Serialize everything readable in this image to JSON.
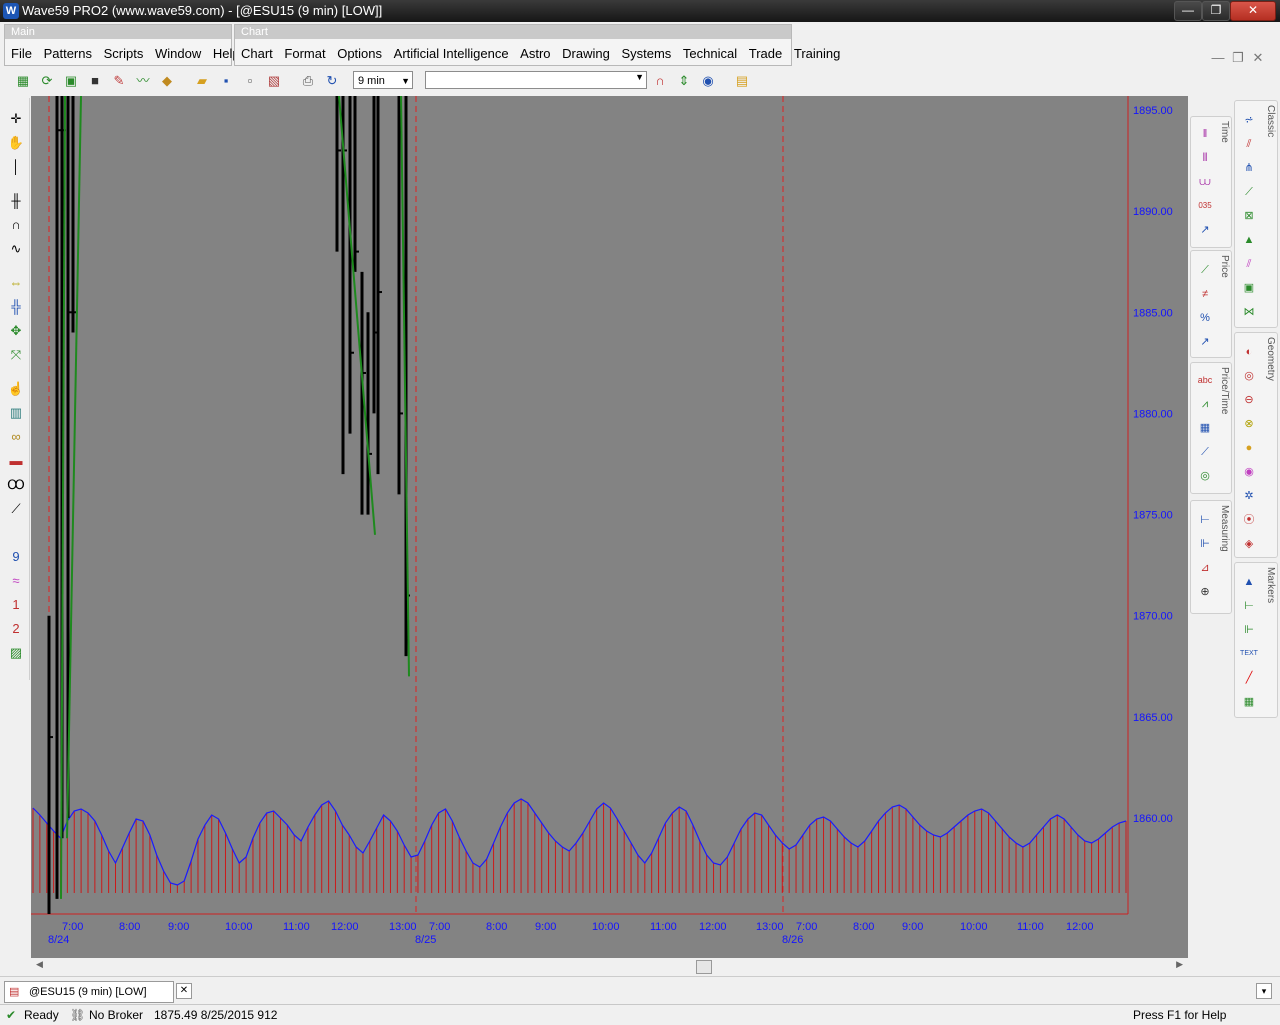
{
  "window": {
    "title": "Wave59 PRO2 (www.wave59.com) - [@ESU15 (9 min) [LOW]]",
    "logo_letter": "W",
    "controls": {
      "minimize": "—",
      "restore": "❐",
      "close": "✕"
    }
  },
  "menus": {
    "main_band_title": "Main",
    "main_items": [
      "File",
      "Patterns",
      "Scripts",
      "Window",
      "Help"
    ],
    "chart_band_title": "Chart",
    "chart_items": [
      "Chart",
      "Format",
      "Options",
      "Artificial Intelligence",
      "Astro",
      "Drawing",
      "Systems",
      "Technical",
      "Trade",
      "Training"
    ]
  },
  "mdi_controls": {
    "minimize": "—",
    "restore": "❐",
    "close": "✕"
  },
  "toolbar": {
    "interval_value": "9 min",
    "symbol_value": ""
  },
  "right_panels": {
    "time": "Time",
    "price": "Price",
    "price_time": "Price/Time",
    "measuring": "Measuring",
    "classic": "Classic",
    "geometry": "Geometry",
    "markers": "Markers"
  },
  "chart_data": {
    "type": "bar",
    "symbol": "@ESU15",
    "interval": "9 min",
    "price_axis_ticks": [
      "1895.00",
      "1890.00",
      "1885.00",
      "1880.00",
      "1875.00",
      "1870.00",
      "1865.00",
      "1860.00"
    ],
    "price_axis_values": [
      1895,
      1890,
      1885,
      1880,
      1875,
      1870,
      1865,
      1860
    ],
    "time_axis_ticks": [
      "7:00",
      "8:00",
      "9:00",
      "10:00",
      "11:00",
      "12:00",
      "13:00",
      "7:00",
      "8:00",
      "9:00",
      "10:00",
      "11:00",
      "12:00",
      "13:00",
      "7:00",
      "8:00",
      "9:00",
      "10:00",
      "11:00",
      "12:00"
    ],
    "date_labels": [
      "8/24",
      "8/25",
      "8/26"
    ],
    "session_breaks": [
      "8/24",
      "8/25",
      "8/26"
    ],
    "ylim": [
      1855,
      1896
    ],
    "price_bars": [
      {
        "session": "8/24",
        "high": 1870,
        "low": 1855,
        "close": 1864
      },
      {
        "session": "8/24",
        "high": 1896,
        "low": 1856,
        "close": 1894
      },
      {
        "session": "8/24",
        "high": 1896,
        "low": 1859,
        "close": 1894
      },
      {
        "session": "8/24",
        "high": 1896,
        "low": 1860,
        "close": 1885
      },
      {
        "session": "8/24",
        "high": 1896,
        "low": 1884,
        "close": 1885
      },
      {
        "session": "8/25",
        "high": 1896,
        "low": 1888,
        "close": 1893
      },
      {
        "session": "8/25",
        "high": 1896,
        "low": 1877,
        "close": 1893
      },
      {
        "session": "8/25",
        "high": 1896,
        "low": 1879,
        "close": 1883
      },
      {
        "session": "8/25",
        "high": 1896,
        "low": 1887,
        "close": 1888
      },
      {
        "session": "8/25",
        "high": 1887,
        "low": 1875,
        "close": 1882
      },
      {
        "session": "8/25",
        "high": 1885,
        "low": 1875,
        "close": 1878
      },
      {
        "session": "8/25",
        "high": 1896,
        "low": 1880,
        "close": 1884
      },
      {
        "session": "8/25",
        "high": 1896,
        "low": 1877,
        "close": 1886
      },
      {
        "session": "8/25",
        "high": 1896,
        "low": 1876,
        "close": 1880
      },
      {
        "session": "8/25",
        "high": 1896,
        "low": 1868,
        "close": 1871
      }
    ],
    "trend_line_segments": [
      {
        "session": "8/24",
        "from_price": 1856,
        "to_price": 1896
      },
      {
        "session": "8/24",
        "from_price": 1859,
        "to_price": 1896
      },
      {
        "session": "8/25",
        "from_price": 1896,
        "to_price": 1874
      },
      {
        "session": "8/25",
        "from_price": 1896,
        "to_price": 1867
      }
    ],
    "indicator": {
      "name": "",
      "line_color": "#1a1aff",
      "histogram_color": "#cc1a1a",
      "values_relative": [
        0.85,
        0.78,
        0.7,
        0.62,
        0.55,
        0.72,
        0.82,
        0.84,
        0.8,
        0.72,
        0.58,
        0.42,
        0.3,
        0.45,
        0.6,
        0.74,
        0.72,
        0.58,
        0.38,
        0.22,
        0.1,
        0.08,
        0.12,
        0.32,
        0.54,
        0.68,
        0.78,
        0.74,
        0.6,
        0.44,
        0.3,
        0.36,
        0.55,
        0.7,
        0.8,
        0.82,
        0.75,
        0.68,
        0.58,
        0.52,
        0.66,
        0.78,
        0.88,
        0.92,
        0.82,
        0.68,
        0.58,
        0.46,
        0.4,
        0.52,
        0.65,
        0.78,
        0.72,
        0.62,
        0.48,
        0.36,
        0.38,
        0.52,
        0.68,
        0.8,
        0.84,
        0.72,
        0.56,
        0.42,
        0.3,
        0.26,
        0.34,
        0.5,
        0.66,
        0.8,
        0.9,
        0.94,
        0.9,
        0.8,
        0.7,
        0.6,
        0.52,
        0.46,
        0.42,
        0.5,
        0.6,
        0.72,
        0.84,
        0.9,
        0.85,
        0.74,
        0.62,
        0.5,
        0.38,
        0.3,
        0.4,
        0.55,
        0.7,
        0.8,
        0.86,
        0.82,
        0.68,
        0.52,
        0.38,
        0.3,
        0.28,
        0.36,
        0.5,
        0.64,
        0.74,
        0.8,
        0.78,
        0.68,
        0.58,
        0.5,
        0.44,
        0.48,
        0.58,
        0.68,
        0.74,
        0.76,
        0.72,
        0.64,
        0.56,
        0.5,
        0.46,
        0.52,
        0.62,
        0.72,
        0.8,
        0.86,
        0.88,
        0.84,
        0.76,
        0.68,
        0.62,
        0.58,
        0.56,
        0.6,
        0.66,
        0.72,
        0.78,
        0.82,
        0.84,
        0.8,
        0.72,
        0.64,
        0.56,
        0.5,
        0.46,
        0.5,
        0.58,
        0.66,
        0.74,
        0.78,
        0.74,
        0.66,
        0.58,
        0.52,
        0.5,
        0.54,
        0.6,
        0.66,
        0.7,
        0.72
      ]
    }
  },
  "document_tab": "@ESU15 (9 min) [LOW]",
  "status": {
    "ready": "Ready",
    "broker": "No Broker",
    "readout": "1875.49  8/25/2015  912",
    "help": "Press F1 for Help"
  }
}
